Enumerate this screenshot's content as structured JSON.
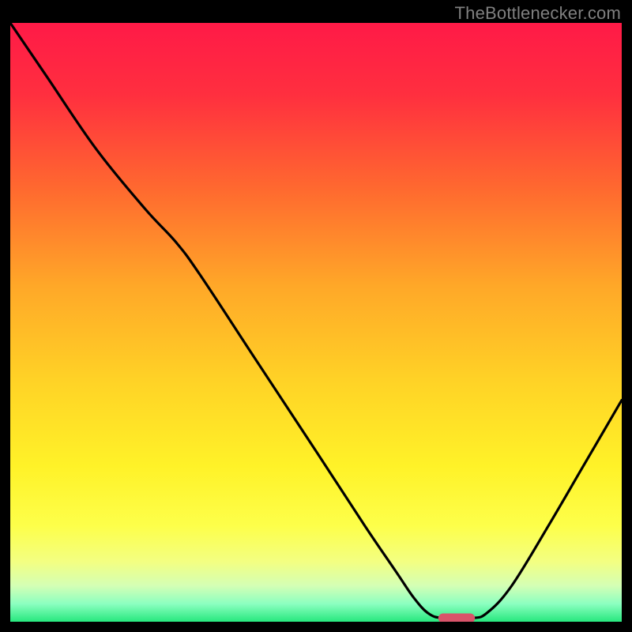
{
  "watermark": "TheBottlenecker.com",
  "chart_data": {
    "type": "line",
    "title": "",
    "xlabel": "",
    "ylabel": "",
    "xlim": [
      0,
      100
    ],
    "ylim": [
      0,
      100
    ],
    "grid": false,
    "background_gradient": {
      "stops": [
        {
          "offset": 0.0,
          "color": "#ff1a47"
        },
        {
          "offset": 0.12,
          "color": "#ff2f3f"
        },
        {
          "offset": 0.28,
          "color": "#ff6a2f"
        },
        {
          "offset": 0.44,
          "color": "#ffa828"
        },
        {
          "offset": 0.6,
          "color": "#ffd326"
        },
        {
          "offset": 0.74,
          "color": "#fff228"
        },
        {
          "offset": 0.84,
          "color": "#fdff4a"
        },
        {
          "offset": 0.9,
          "color": "#f3ff82"
        },
        {
          "offset": 0.94,
          "color": "#d4ffb5"
        },
        {
          "offset": 0.97,
          "color": "#8cffc0"
        },
        {
          "offset": 1.0,
          "color": "#27e87e"
        }
      ]
    },
    "series": [
      {
        "name": "bottleneck-curve",
        "stroke": "#000000",
        "points": [
          {
            "x": 0.0,
            "y": 100.0
          },
          {
            "x": 6.0,
            "y": 91.0
          },
          {
            "x": 14.0,
            "y": 79.0
          },
          {
            "x": 22.0,
            "y": 69.0
          },
          {
            "x": 27.0,
            "y": 63.5
          },
          {
            "x": 31.0,
            "y": 58.0
          },
          {
            "x": 40.0,
            "y": 44.0
          },
          {
            "x": 50.0,
            "y": 28.5
          },
          {
            "x": 58.0,
            "y": 16.0
          },
          {
            "x": 63.0,
            "y": 8.5
          },
          {
            "x": 66.0,
            "y": 4.0
          },
          {
            "x": 68.5,
            "y": 1.3
          },
          {
            "x": 71.0,
            "y": 0.6
          },
          {
            "x": 75.5,
            "y": 0.6
          },
          {
            "x": 78.0,
            "y": 1.5
          },
          {
            "x": 82.0,
            "y": 6.0
          },
          {
            "x": 88.0,
            "y": 16.0
          },
          {
            "x": 94.0,
            "y": 26.5
          },
          {
            "x": 100.0,
            "y": 37.0
          }
        ]
      }
    ],
    "marker": {
      "name": "optimal-pill",
      "color": "#d9546a",
      "x_center": 73.0,
      "y": 0.6,
      "width_pct": 6.0
    }
  }
}
